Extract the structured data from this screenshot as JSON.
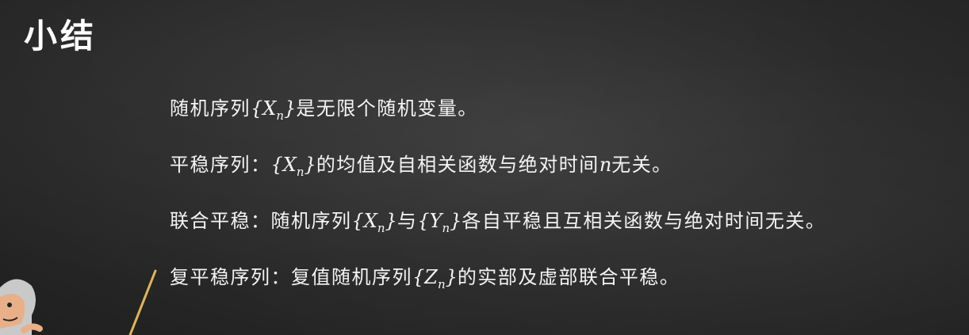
{
  "title": "小结",
  "lines": [
    {
      "parts": [
        {
          "text": "随机序列",
          "math": false
        },
        {
          "text": "{X",
          "math": true,
          "sub": "n",
          "close": "}"
        },
        {
          "text": "是无限个随机变量。",
          "math": false
        }
      ]
    },
    {
      "parts": [
        {
          "text": "平稳序列：",
          "math": false
        },
        {
          "text": "{X",
          "math": true,
          "sub": "n",
          "close": "}"
        },
        {
          "text": "的均值及自相关函数与绝对时间",
          "math": false
        },
        {
          "text": "n",
          "math": true
        },
        {
          "text": "无关。",
          "math": false
        }
      ]
    },
    {
      "parts": [
        {
          "text": "联合平稳：随机序列",
          "math": false
        },
        {
          "text": "{X",
          "math": true,
          "sub": "n",
          "close": "}"
        },
        {
          "text": "与",
          "math": false
        },
        {
          "text": "{Y",
          "math": true,
          "sub": "n",
          "close": "}"
        },
        {
          "text": "各自平稳且互相关函数与绝对时间无关。",
          "math": false
        }
      ]
    },
    {
      "parts": [
        {
          "text": "复平稳序列：复值随机序列",
          "math": false
        },
        {
          "text": "{Z",
          "math": true,
          "sub": "n",
          "close": "}"
        },
        {
          "text": "的实部及虚部联合平稳。",
          "math": false
        }
      ]
    }
  ],
  "colors": {
    "background": "#2c2c2c",
    "text": "#f4f4f4",
    "pointer": "#e0b45a",
    "figure_skin": "#e8b089",
    "figure_hair": "#c9c9c9"
  }
}
